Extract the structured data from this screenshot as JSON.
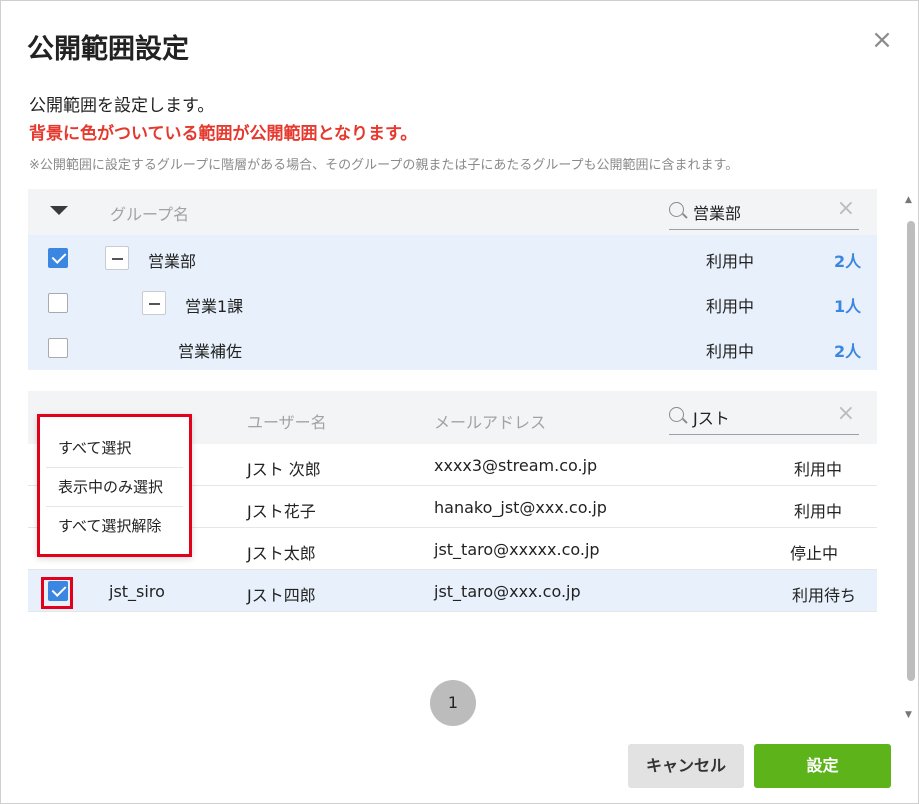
{
  "dialog": {
    "title": "公開範囲設定",
    "description": "公開範囲を設定します。",
    "warning": "背景に色がついている範囲が公開範囲となります。",
    "note": "※公開範囲に設定するグループに階層がある場合、そのグループの親または子にあたるグループも公開範囲に含まれます。"
  },
  "group_table": {
    "header_label": "グループ名",
    "search_value": "営業部",
    "rows": [
      {
        "name": "営業部",
        "status": "利用中",
        "count": "2人",
        "checked": true
      },
      {
        "name": "営業1課",
        "status": "利用中",
        "count": "1人",
        "checked": false
      },
      {
        "name": "営業補佐",
        "status": "利用中",
        "count": "2人",
        "checked": false
      }
    ]
  },
  "user_table": {
    "header_username": "ユーザー名",
    "header_email": "メールアドレス",
    "search_value": "Jスト",
    "rows": [
      {
        "id": "",
        "name": "Jスト 次郎",
        "email": "xxxx3@stream.co.jp",
        "status": "利用中"
      },
      {
        "id": "",
        "name": "Jスト花子",
        "email": "hanako_jst@xxx.co.jp",
        "status": "利用中"
      },
      {
        "id": "",
        "name": "Jスト太郎",
        "email": "jst_taro@xxxxx.co.jp",
        "status": "停止中"
      },
      {
        "id": "jst_siro",
        "name": "Jスト四郎",
        "email": "jst_taro@xxx.co.jp",
        "status": "利用待ち",
        "checked": true
      }
    ]
  },
  "select_menu": {
    "items": [
      "すべて選択",
      "表示中のみ選択",
      "すべて選択解除"
    ]
  },
  "pagination": {
    "current": "1"
  },
  "buttons": {
    "cancel": "キャンセル",
    "ok": "設定"
  },
  "colors": {
    "accent_blue": "#3b86e0",
    "warning_red": "#e6392e",
    "highlight_red": "#e2001a",
    "primary_green": "#5cb31a",
    "selected_bg": "#e8f1fb"
  }
}
